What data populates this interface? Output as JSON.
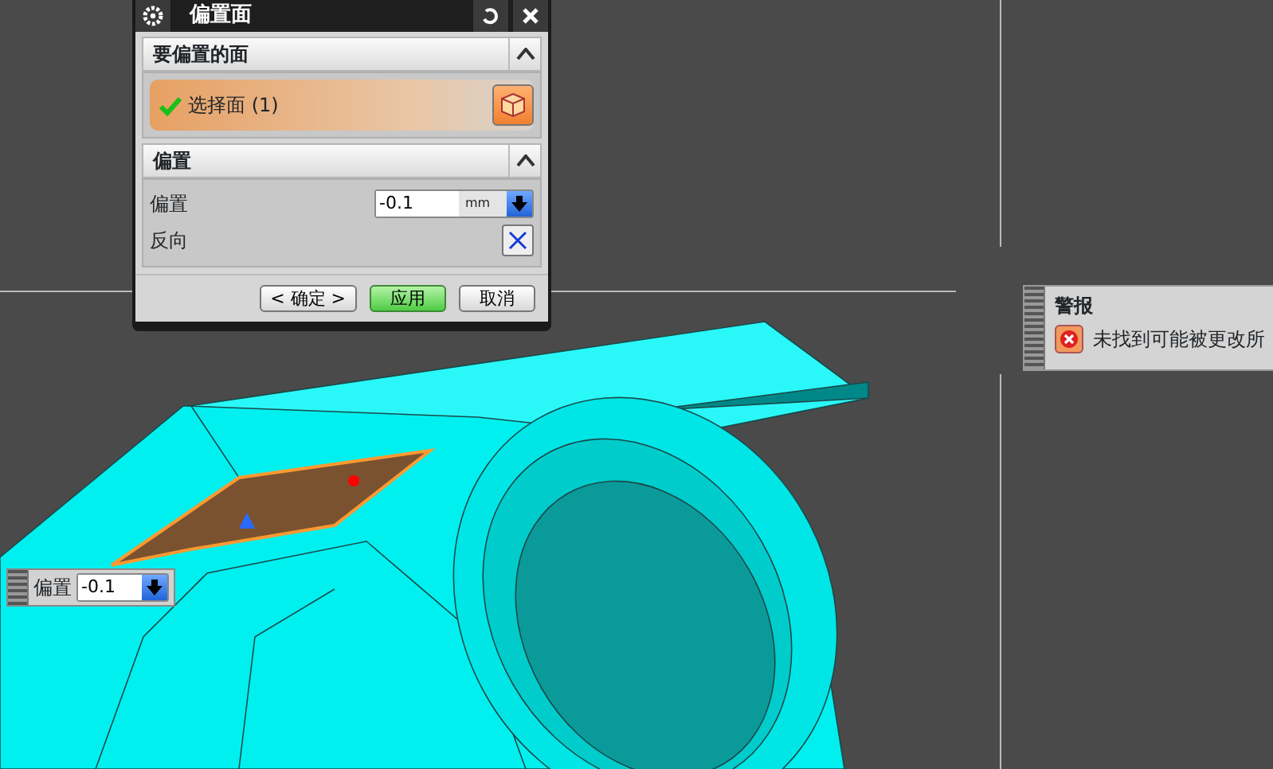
{
  "dialog": {
    "title": "偏置面",
    "face_section": {
      "title": "要偏置的面",
      "expanded": true
    },
    "select_face": {
      "label": "选择面 (1)",
      "checked": true
    },
    "offset_section": {
      "title": "偏置",
      "expanded": true
    },
    "offset_field": {
      "label": "偏置",
      "value": "-0.1",
      "unit": "mm"
    },
    "reverse": {
      "label": "反向"
    },
    "buttons": [
      {
        "label": "< 确定 >",
        "kind": "default"
      },
      {
        "label": "应用",
        "kind": "primary"
      },
      {
        "label": "取消",
        "kind": "default"
      }
    ]
  },
  "alert": {
    "title": "警报",
    "message": "未找到可能被更改所"
  },
  "floating_field": {
    "label": "偏置",
    "value": "-0.1"
  }
}
